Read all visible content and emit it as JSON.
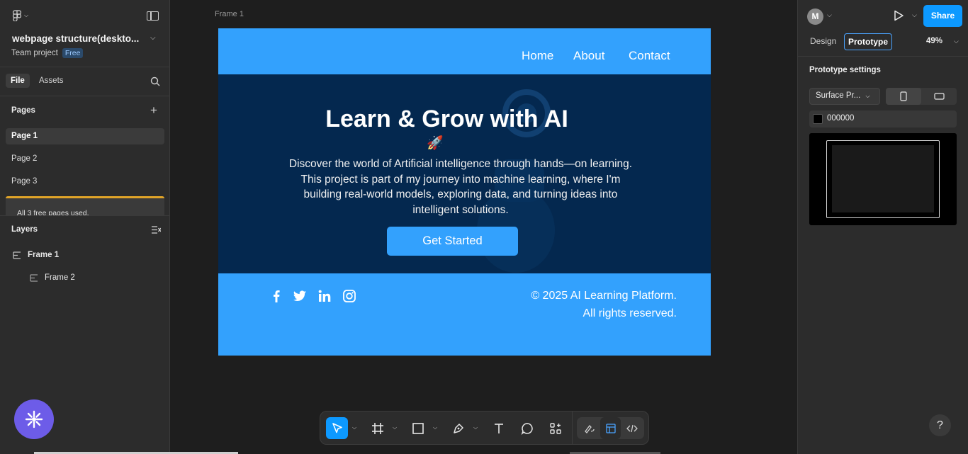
{
  "project": {
    "title": "webpage structure(deskto...",
    "team": "Team project",
    "plan_badge": "Free"
  },
  "left_tabs": {
    "file": "File",
    "assets": "Assets"
  },
  "pages": {
    "heading": "Pages",
    "items": [
      "Page 1",
      "Page 2",
      "Page 3"
    ],
    "selected": "Page 1",
    "notice": "All 3 free pages used."
  },
  "layers": {
    "heading": "Layers",
    "items": [
      {
        "name": "Frame 1",
        "level": 0
      },
      {
        "name": "Frame 2",
        "level": 1
      }
    ]
  },
  "canvas": {
    "frame_label": "Frame 1",
    "nav": [
      "Home",
      "About",
      "Contact"
    ],
    "hero_title": "Learn & Grow with  AI",
    "hero_emoji": "🚀",
    "hero_text": "Discover the world of Artificial intelligence through hands—on learning. This project is part of my journey into machine learning, where I'm building real-world models, exploring data, and turning ideas into intelligent solutions.",
    "cta": "Get Started",
    "footer_line1": "© 2025 AI Learning Platform.",
    "footer_line2": "All rights reserved.",
    "social_icons": [
      "facebook-icon",
      "twitter-icon",
      "linkedin-icon",
      "instagram-icon"
    ],
    "colors": {
      "header": "#33a1fd",
      "hero_bg": "#04284f",
      "cta": "#33a1fd"
    }
  },
  "right_panel": {
    "avatar_initial": "M",
    "share": "Share",
    "tabs": {
      "design": "Design",
      "prototype": "Prototype"
    },
    "zoom": "49%",
    "prototype_settings": "Prototype settings",
    "device": "Surface Pr...",
    "bg_color": "000000"
  },
  "help": "?",
  "colors": {
    "accent": "#0d99ff",
    "panel": "#2c2c2c",
    "canvas": "#1e1e1e",
    "warning": "#e0a428"
  }
}
